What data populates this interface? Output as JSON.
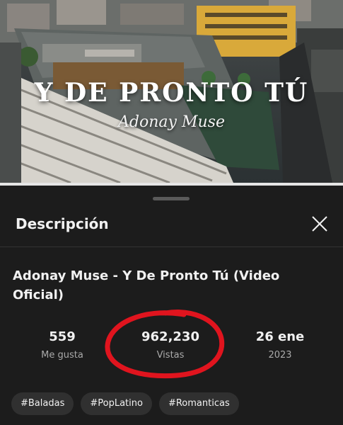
{
  "video": {
    "overlay_title": "Y DE PRONTO TÚ",
    "overlay_artist": "Adonay Muse",
    "progress": 1.0
  },
  "sheet": {
    "title": "Descripción",
    "video_title": "Adonay Muse - Y De Pronto Tú (Video Oficial)"
  },
  "stats": {
    "likes": {
      "value": "559",
      "label": "Me gusta"
    },
    "views": {
      "value": "962,230",
      "label": "Vistas"
    },
    "date": {
      "value": "26 ene",
      "label": "2023"
    }
  },
  "tags": [
    "#Baladas",
    "#PopLatino",
    "#Romanticas"
  ],
  "colors": {
    "sheet_bg": "#1c1c1c",
    "chip_bg": "#303030",
    "annotation_circle": "#e0141e"
  },
  "icons": {
    "close": "close-icon"
  }
}
